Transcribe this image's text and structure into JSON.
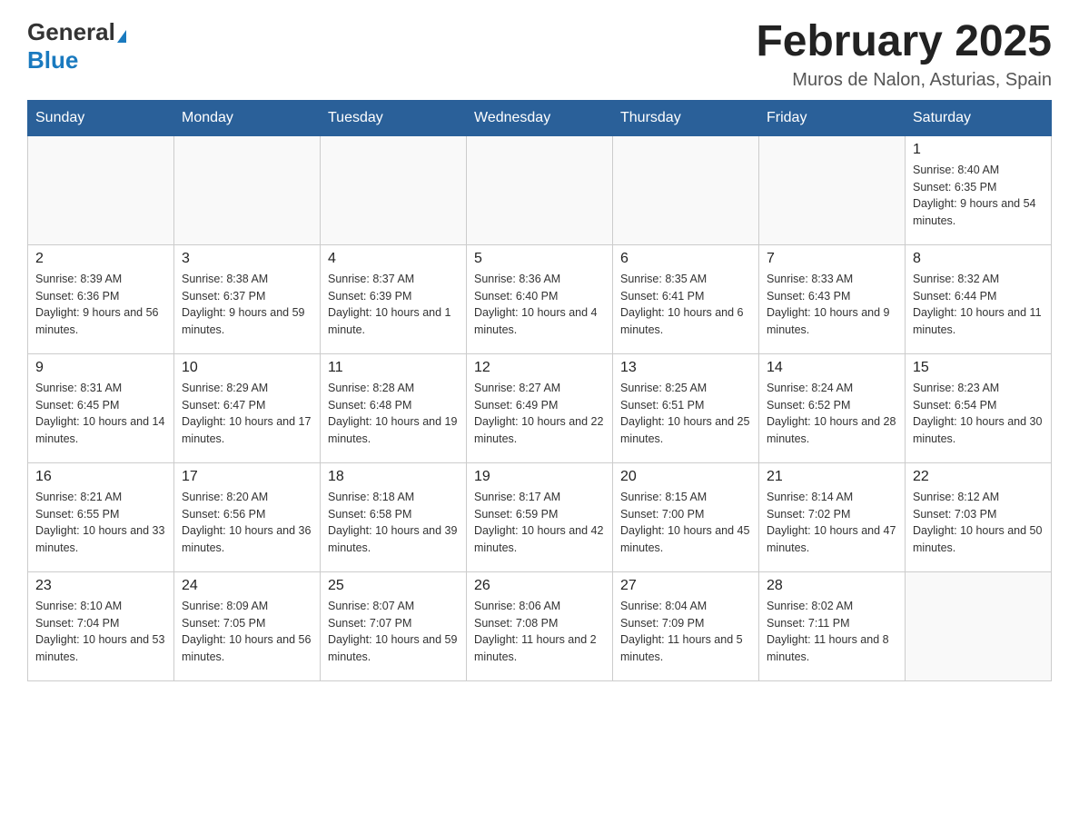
{
  "header": {
    "logo_general": "General",
    "logo_blue": "Blue",
    "title": "February 2025",
    "subtitle": "Muros de Nalon, Asturias, Spain"
  },
  "weekdays": [
    "Sunday",
    "Monday",
    "Tuesday",
    "Wednesday",
    "Thursday",
    "Friday",
    "Saturday"
  ],
  "weeks": [
    [
      {
        "day": "",
        "info": ""
      },
      {
        "day": "",
        "info": ""
      },
      {
        "day": "",
        "info": ""
      },
      {
        "day": "",
        "info": ""
      },
      {
        "day": "",
        "info": ""
      },
      {
        "day": "",
        "info": ""
      },
      {
        "day": "1",
        "info": "Sunrise: 8:40 AM\nSunset: 6:35 PM\nDaylight: 9 hours and 54 minutes."
      }
    ],
    [
      {
        "day": "2",
        "info": "Sunrise: 8:39 AM\nSunset: 6:36 PM\nDaylight: 9 hours and 56 minutes."
      },
      {
        "day": "3",
        "info": "Sunrise: 8:38 AM\nSunset: 6:37 PM\nDaylight: 9 hours and 59 minutes."
      },
      {
        "day": "4",
        "info": "Sunrise: 8:37 AM\nSunset: 6:39 PM\nDaylight: 10 hours and 1 minute."
      },
      {
        "day": "5",
        "info": "Sunrise: 8:36 AM\nSunset: 6:40 PM\nDaylight: 10 hours and 4 minutes."
      },
      {
        "day": "6",
        "info": "Sunrise: 8:35 AM\nSunset: 6:41 PM\nDaylight: 10 hours and 6 minutes."
      },
      {
        "day": "7",
        "info": "Sunrise: 8:33 AM\nSunset: 6:43 PM\nDaylight: 10 hours and 9 minutes."
      },
      {
        "day": "8",
        "info": "Sunrise: 8:32 AM\nSunset: 6:44 PM\nDaylight: 10 hours and 11 minutes."
      }
    ],
    [
      {
        "day": "9",
        "info": "Sunrise: 8:31 AM\nSunset: 6:45 PM\nDaylight: 10 hours and 14 minutes."
      },
      {
        "day": "10",
        "info": "Sunrise: 8:29 AM\nSunset: 6:47 PM\nDaylight: 10 hours and 17 minutes."
      },
      {
        "day": "11",
        "info": "Sunrise: 8:28 AM\nSunset: 6:48 PM\nDaylight: 10 hours and 19 minutes."
      },
      {
        "day": "12",
        "info": "Sunrise: 8:27 AM\nSunset: 6:49 PM\nDaylight: 10 hours and 22 minutes."
      },
      {
        "day": "13",
        "info": "Sunrise: 8:25 AM\nSunset: 6:51 PM\nDaylight: 10 hours and 25 minutes."
      },
      {
        "day": "14",
        "info": "Sunrise: 8:24 AM\nSunset: 6:52 PM\nDaylight: 10 hours and 28 minutes."
      },
      {
        "day": "15",
        "info": "Sunrise: 8:23 AM\nSunset: 6:54 PM\nDaylight: 10 hours and 30 minutes."
      }
    ],
    [
      {
        "day": "16",
        "info": "Sunrise: 8:21 AM\nSunset: 6:55 PM\nDaylight: 10 hours and 33 minutes."
      },
      {
        "day": "17",
        "info": "Sunrise: 8:20 AM\nSunset: 6:56 PM\nDaylight: 10 hours and 36 minutes."
      },
      {
        "day": "18",
        "info": "Sunrise: 8:18 AM\nSunset: 6:58 PM\nDaylight: 10 hours and 39 minutes."
      },
      {
        "day": "19",
        "info": "Sunrise: 8:17 AM\nSunset: 6:59 PM\nDaylight: 10 hours and 42 minutes."
      },
      {
        "day": "20",
        "info": "Sunrise: 8:15 AM\nSunset: 7:00 PM\nDaylight: 10 hours and 45 minutes."
      },
      {
        "day": "21",
        "info": "Sunrise: 8:14 AM\nSunset: 7:02 PM\nDaylight: 10 hours and 47 minutes."
      },
      {
        "day": "22",
        "info": "Sunrise: 8:12 AM\nSunset: 7:03 PM\nDaylight: 10 hours and 50 minutes."
      }
    ],
    [
      {
        "day": "23",
        "info": "Sunrise: 8:10 AM\nSunset: 7:04 PM\nDaylight: 10 hours and 53 minutes."
      },
      {
        "day": "24",
        "info": "Sunrise: 8:09 AM\nSunset: 7:05 PM\nDaylight: 10 hours and 56 minutes."
      },
      {
        "day": "25",
        "info": "Sunrise: 8:07 AM\nSunset: 7:07 PM\nDaylight: 10 hours and 59 minutes."
      },
      {
        "day": "26",
        "info": "Sunrise: 8:06 AM\nSunset: 7:08 PM\nDaylight: 11 hours and 2 minutes."
      },
      {
        "day": "27",
        "info": "Sunrise: 8:04 AM\nSunset: 7:09 PM\nDaylight: 11 hours and 5 minutes."
      },
      {
        "day": "28",
        "info": "Sunrise: 8:02 AM\nSunset: 7:11 PM\nDaylight: 11 hours and 8 minutes."
      },
      {
        "day": "",
        "info": ""
      }
    ]
  ]
}
